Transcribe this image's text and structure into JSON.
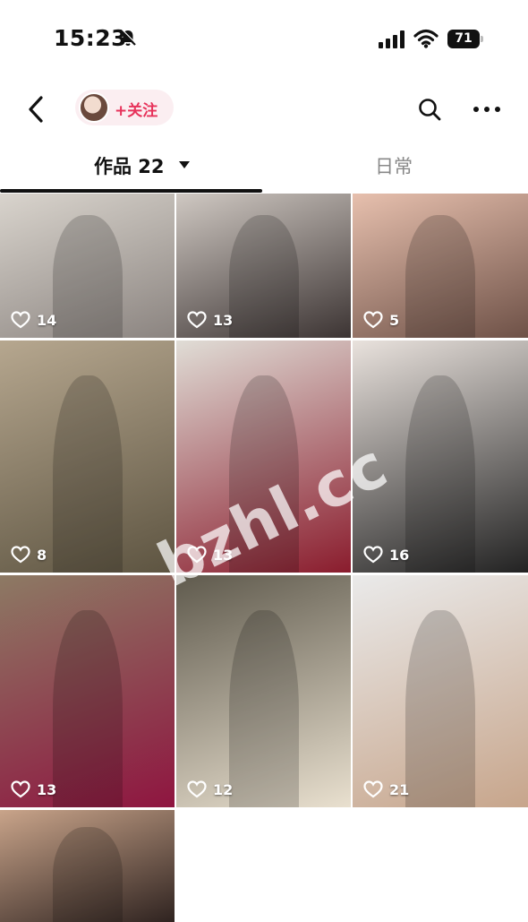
{
  "status_bar": {
    "time": "15:23",
    "battery": "71"
  },
  "nav": {
    "follow_label": "+关注"
  },
  "tabs": {
    "works_label": "作品 22",
    "daily_label": "日常"
  },
  "posts": [
    {
      "likes": "14",
      "colors": [
        "#d9d4cd",
        "#8b8480"
      ]
    },
    {
      "likes": "13",
      "colors": [
        "#cfc8c2",
        "#3c3433"
      ]
    },
    {
      "likes": "5",
      "colors": [
        "#e7c0ae",
        "#6e5147"
      ]
    },
    {
      "likes": "8",
      "colors": [
        "#b6a78f",
        "#5d5441"
      ]
    },
    {
      "likes": "13",
      "colors": [
        "#e0ddd6",
        "#8a1c2d"
      ]
    },
    {
      "likes": "16",
      "colors": [
        "#e9e2dd",
        "#222222"
      ]
    },
    {
      "likes": "13",
      "colors": [
        "#8d7a64",
        "#8f1540"
      ]
    },
    {
      "likes": "12",
      "colors": [
        "#5f5a4d",
        "#e9e0cf"
      ]
    },
    {
      "likes": "21",
      "colors": [
        "#eaeaea",
        "#c7a58b"
      ]
    },
    {
      "likes": "",
      "colors": [
        "#c9a48a",
        "#2f2320"
      ]
    }
  ],
  "watermark": "bzhl.cc"
}
